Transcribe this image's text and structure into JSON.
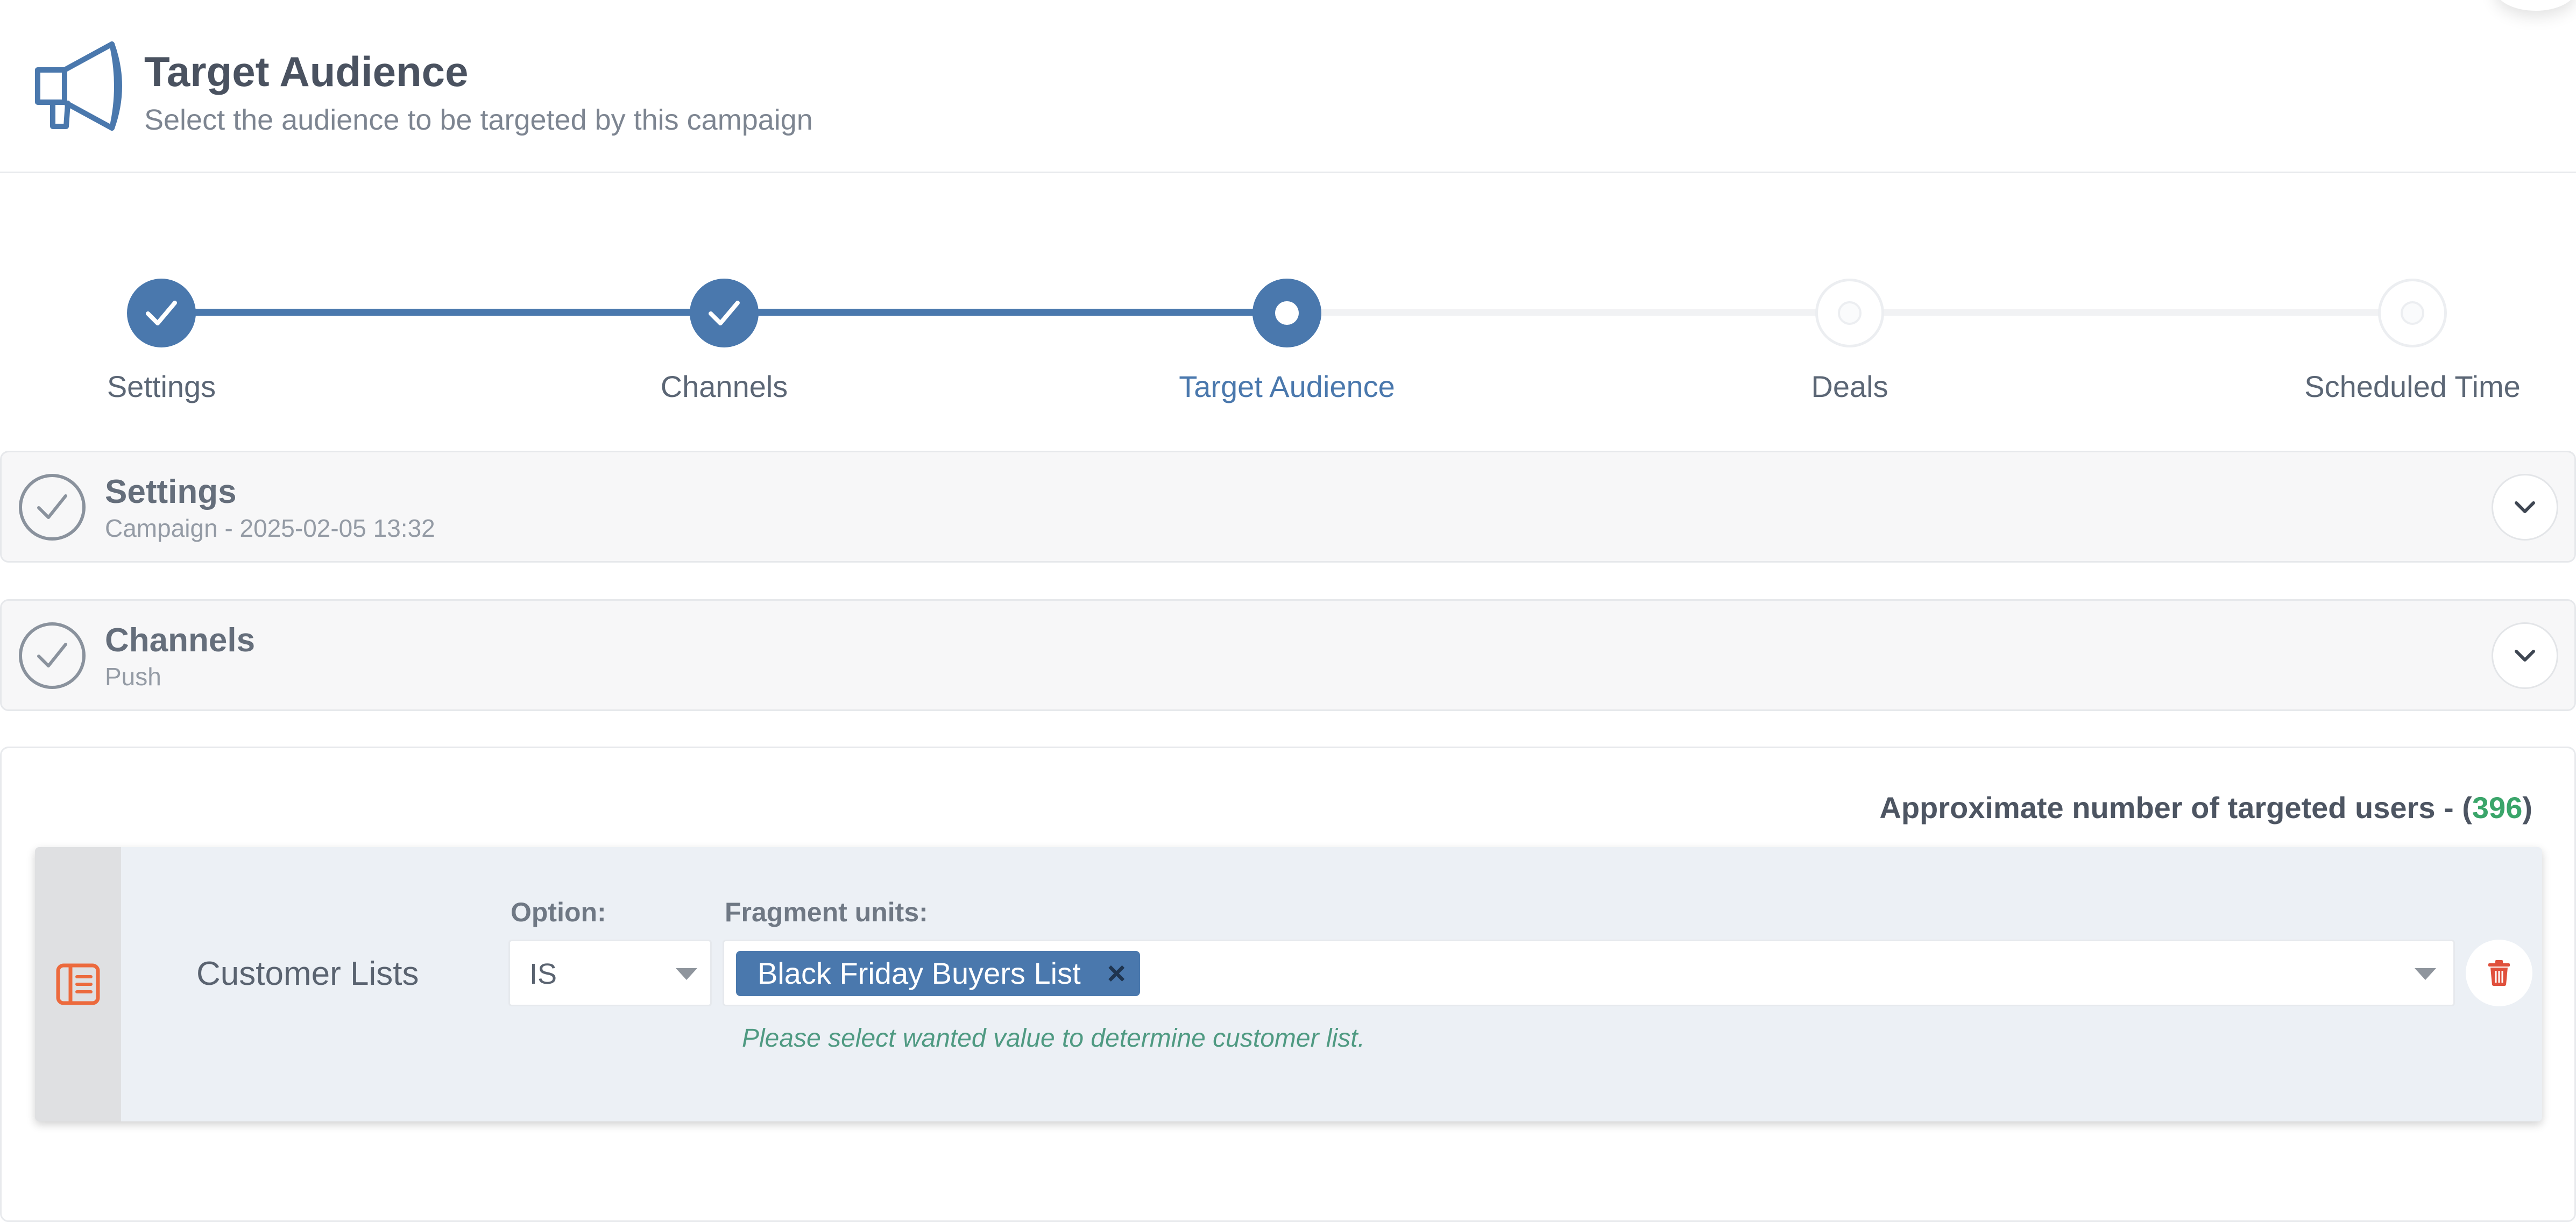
{
  "header": {
    "title": "Target Audience",
    "subtitle": "Select the audience to be targeted by this campaign",
    "icon": "megaphone-icon"
  },
  "stepper": {
    "steps": [
      {
        "label": "Settings",
        "state": "done"
      },
      {
        "label": "Channels",
        "state": "done"
      },
      {
        "label": "Target Audience",
        "state": "active"
      },
      {
        "label": "Deals",
        "state": "todo"
      },
      {
        "label": "Scheduled Time",
        "state": "todo"
      }
    ]
  },
  "panels": {
    "settings": {
      "title": "Settings",
      "subtitle": "Campaign - 2025-02-05 13:32"
    },
    "channels": {
      "title": "Channels",
      "subtitle": "Push"
    }
  },
  "audience": {
    "approx_prefix": "Approximate number of targeted users - (",
    "approx_count": "396",
    "approx_suffix": ")",
    "rule": {
      "name": "Customer Lists",
      "option_label": "Option:",
      "option_value": "IS",
      "units_label": "Fragment units:",
      "chip": "Black Friday Buyers List",
      "chip_remove": "×",
      "hint": "Please select wanted value to determine customer list."
    }
  },
  "colors": {
    "accent": "#4a78ad",
    "count_green": "#3aa56a",
    "delete_red": "#e0503c",
    "list_icon_orange": "#ec6a3d",
    "hint_green": "#4f9a82"
  }
}
